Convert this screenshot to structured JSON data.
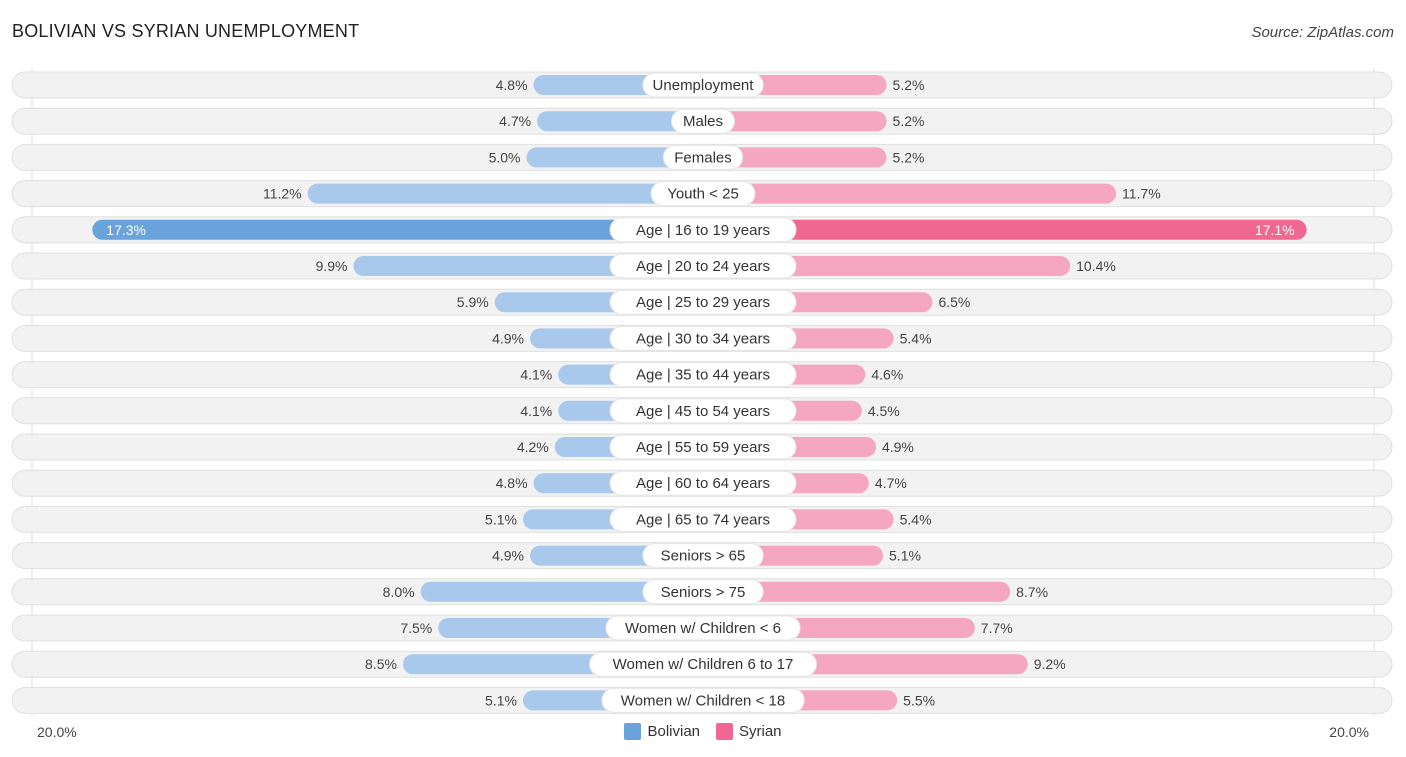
{
  "header": {
    "title": "BOLIVIAN VS SYRIAN UNEMPLOYMENT",
    "source": "Source: ZipAtlas.com"
  },
  "colors": {
    "bolivian": "#6aa2dc",
    "bolivian_light": "#a8c8ec",
    "syrian": "#f06892",
    "syrian_light": "#f5a6c0",
    "row_bg": "#f2f2f2"
  },
  "chart_data": {
    "type": "bar",
    "orientation": "horizontal-diverging",
    "title": "BOLIVIAN VS SYRIAN UNEMPLOYMENT",
    "xlim": [
      -20,
      20
    ],
    "axis_labels": {
      "left": "20.0%",
      "right": "20.0%"
    },
    "legend": {
      "position": "bottom-center",
      "items": [
        "Bolivian",
        "Syrian"
      ]
    },
    "categories": [
      "Unemployment",
      "Males",
      "Females",
      "Youth < 25",
      "Age | 16 to 19 years",
      "Age | 20 to 24 years",
      "Age | 25 to 29 years",
      "Age | 30 to 34 years",
      "Age | 35 to 44 years",
      "Age | 45 to 54 years",
      "Age | 55 to 59 years",
      "Age | 60 to 64 years",
      "Age | 65 to 74 years",
      "Seniors > 65",
      "Seniors > 75",
      "Women w/ Children < 6",
      "Women w/ Children 6 to 17",
      "Women w/ Children < 18"
    ],
    "series": [
      {
        "name": "Bolivian",
        "values": [
          4.8,
          4.7,
          5.0,
          11.2,
          17.3,
          9.9,
          5.9,
          4.9,
          4.1,
          4.1,
          4.2,
          4.8,
          5.1,
          4.9,
          8.0,
          7.5,
          8.5,
          5.1
        ],
        "labels": [
          "4.8%",
          "4.7%",
          "5.0%",
          "11.2%",
          "17.3%",
          "9.9%",
          "5.9%",
          "4.9%",
          "4.1%",
          "4.1%",
          "4.2%",
          "4.8%",
          "5.1%",
          "4.9%",
          "8.0%",
          "7.5%",
          "8.5%",
          "5.1%"
        ]
      },
      {
        "name": "Syrian",
        "values": [
          5.2,
          5.2,
          5.2,
          11.7,
          17.1,
          10.4,
          6.5,
          5.4,
          4.6,
          4.5,
          4.9,
          4.7,
          5.4,
          5.1,
          8.7,
          7.7,
          9.2,
          5.5
        ],
        "labels": [
          "5.2%",
          "5.2%",
          "5.2%",
          "11.7%",
          "17.1%",
          "10.4%",
          "6.5%",
          "5.4%",
          "4.6%",
          "4.5%",
          "4.9%",
          "4.7%",
          "5.4%",
          "5.1%",
          "8.7%",
          "7.7%",
          "9.2%",
          "5.5%"
        ]
      }
    ]
  }
}
